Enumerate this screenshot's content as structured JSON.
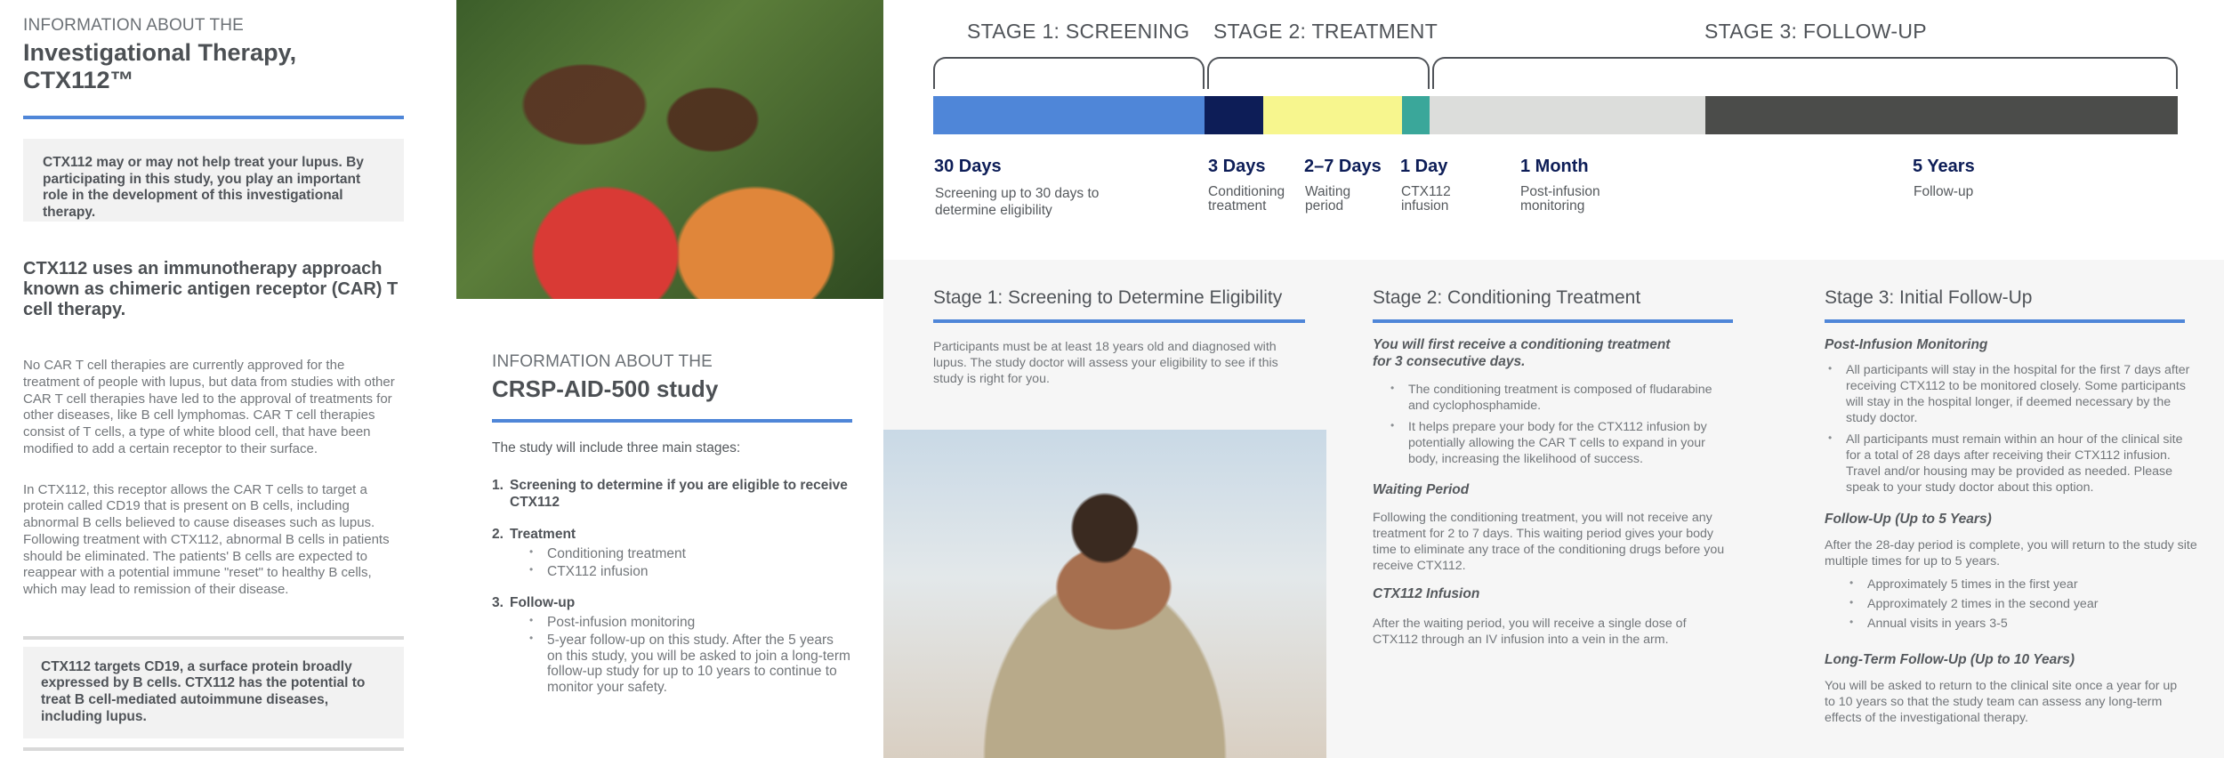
{
  "col1": {
    "overline": "INFORMATION ABOUT THE",
    "title": "Investigational Therapy, CTX112™",
    "callout1": "CTX112 may or may not help treat your lupus. By participating in this study, you play an important role in the development of this investigational therapy.",
    "lead": "CTX112 uses an immunotherapy approach known as chimeric antigen receptor (CAR) T cell therapy.",
    "para1": "No CAR T cell therapies are currently approved for the treatment of people with lupus, but data from studies with other CAR T cell therapies have led to the approval of treatments for other diseases, like B cell lymphomas. CAR T cell therapies consist of T cells, a type of white blood cell, that have been modified to add a certain receptor to their surface.",
    "para2": "In CTX112, this receptor allows the CAR T cells to target a protein called CD19 that is present on B cells, including abnormal B cells believed to cause diseases such as lupus. Following treatment with CTX112, abnormal B cells in patients should be eliminated. The patients' B cells are expected to reappear with a potential immune \"reset\" to healthy B cells, which may lead to remission of their disease.",
    "callout2": "CTX112 targets CD19, a surface protein broadly expressed by B cells. CTX112 has the potential to treat B cell-mediated autoimmune diseases, including lupus."
  },
  "col2": {
    "overline": "INFORMATION ABOUT THE",
    "title": "CRSP-AID-500 study",
    "intro": "The study will include three main stages:",
    "stages": [
      {
        "num": "1.",
        "label": "Screening to determine if you are eligible to receive CTX112",
        "items": []
      },
      {
        "num": "2.",
        "label": "Treatment",
        "items": [
          "Conditioning treatment",
          "CTX112 infusion"
        ]
      },
      {
        "num": "3.",
        "label": "Follow-up",
        "items": [
          "Post-infusion monitoring",
          "5-year follow-up on this study. After the 5 years on this study, you will be asked to join a long-term follow-up study for up to 10 years to continue to monitor your safety."
        ]
      }
    ]
  },
  "timeline": {
    "stage1": "STAGE 1: SCREENING",
    "stage2": "STAGE 2: TREATMENT",
    "stage3": "STAGE 3: FOLLOW-UP",
    "colors": [
      "#4f86d8",
      "#0d1d57",
      "#f7f68e",
      "#3aa79a",
      "#dcdddb",
      "#4b4c4a"
    ],
    "durations": [
      {
        "dur": "30 Days",
        "sub": "Screening up to 30 days to determine eligibility"
      },
      {
        "dur": "3 Days",
        "sub": "Conditioning treatment"
      },
      {
        "dur": "2–7 Days",
        "sub": "Waiting period"
      },
      {
        "dur": "1 Day",
        "sub": "CTX112 infusion"
      },
      {
        "dur": "1 Month",
        "sub": "Post-infusion monitoring"
      },
      {
        "dur": "5 Years",
        "sub": "Follow-up"
      }
    ]
  },
  "panel": {
    "s1": {
      "title": "Stage 1: Screening to Determine Eligibility",
      "text": "Participants must be at least 18 years old and diagnosed with lupus. The study doctor will assess your eligibility to see if this study is right for you."
    },
    "s2": {
      "title": "Stage 2: Conditioning Treatment",
      "intro": "You will first receive a conditioning treatment for 3 consecutive days.",
      "bullets": [
        "The conditioning treatment is composed of fludarabine and cyclophosphamide.",
        "It helps prepare your body for the CTX112 infusion by potentially allowing the CAR T cells to expand in your body, increasing the likelihood of success."
      ],
      "waiting_head": "Waiting Period",
      "waiting_text": "Following the conditioning treatment, you will not receive any treatment for 2 to 7 days. This waiting period gives your body time to eliminate any trace of the conditioning drugs before you receive CTX112.",
      "infusion_head": "CTX112 Infusion",
      "infusion_text": "After the waiting period, you will receive a single dose of CTX112 through an IV infusion into a vein in the arm."
    },
    "s3": {
      "title": "Stage 3: Initial Follow-Up",
      "post_head": "Post-Infusion Monitoring",
      "post_bullets": [
        "All participants will stay in the hospital for the first 7 days after receiving CTX112 to be monitored closely. Some participants will stay in the hospital longer, if deemed necessary by the study doctor.",
        "All participants must remain within an hour of the clinical site for a total of 28 days after receiving their CTX112 infusion. Travel and/or housing may be provided as needed. Please speak to your study doctor about this option."
      ],
      "fu_head": "Follow-Up (Up to 5 Years)",
      "fu_text": "After the 28-day period is complete, you will return to the study site multiple times for up to 5 years.",
      "fu_bullets": [
        "Approximately 5 times in the first year",
        "Approximately 2 times in the second year",
        "Annual visits in years 3-5"
      ],
      "lt_head": "Long-Term Follow-Up (Up to 10 Years)",
      "lt_text": "You will be asked to return to the clinical site once a year for up to 10 years so that the study team can assess any long-term effects of the investigational therapy."
    }
  }
}
